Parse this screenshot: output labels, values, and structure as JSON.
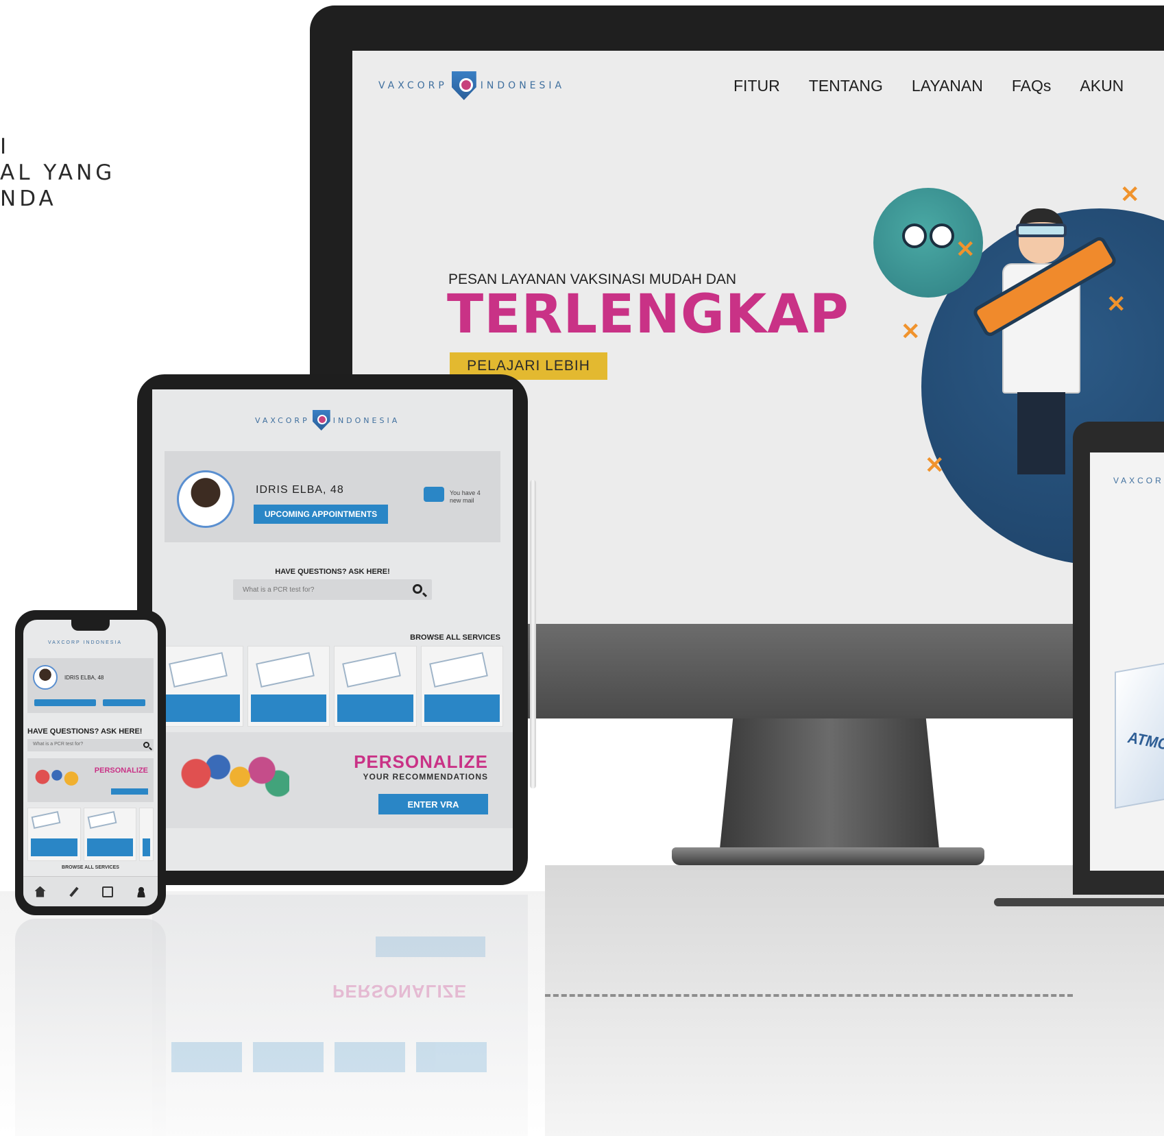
{
  "side_copy": {
    "line1": "I",
    "line2": "AL YANG",
    "line3": "NDA"
  },
  "desktop": {
    "logo_left": "VAXCORP",
    "logo_right": "INDONESIA",
    "nav": [
      "FITUR",
      "TENTANG",
      "LAYANAN",
      "FAQs",
      "AKUN"
    ],
    "hero_subtitle": "PESAN LAYANAN VAKSINASI MUDAH DAN",
    "hero_title": "TERLENGKAP",
    "hero_cta": "PELAJARI LEBIH"
  },
  "laptop": {
    "logo": "VAXCOR",
    "box_label": "ATMC"
  },
  "tablet": {
    "logo_left": "VAXCORP",
    "logo_right": "INDONESIA",
    "user_name": "IDRIS ELBA,  48",
    "appointments_button": "UPCOMING APPOINTMENTS",
    "mail_text": "You have 4 new mail",
    "questions_heading": "HAVE QUESTIONS? ASK HERE!",
    "search_placeholder": "What is a PCR test for?",
    "browse_label": "BROWSE ALL SERVICES",
    "personalize_title": "PERSONALIZE",
    "personalize_subtitle": "YOUR RECOMMENDATIONS",
    "vra_button": "ENTER VRA"
  },
  "phone": {
    "logo": "VAXCORP INDONESIA",
    "user_name": "IDRIS ELBA, 48",
    "questions_heading": "HAVE QUESTIONS? ASK HERE!",
    "search_placeholder": "What is a PCR test for?",
    "personalize_title": "PERSONALIZE",
    "browse_label": "BROWSE ALL SERVICES",
    "tabs": [
      "home-icon",
      "pen-icon",
      "calendar-icon",
      "user-icon"
    ]
  },
  "colors": {
    "brand_pink": "#c93286",
    "brand_blue": "#2a86c6",
    "cta_yellow": "#e3b930"
  }
}
